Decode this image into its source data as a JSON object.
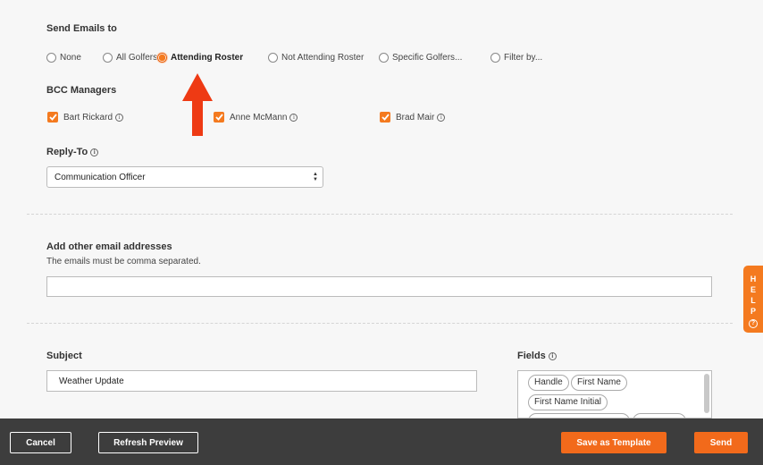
{
  "send_emails": {
    "label": "Send Emails to",
    "options": [
      "None",
      "All Golfers",
      "Attending Roster",
      "Not Attending Roster",
      "Specific Golfers...",
      "Filter by..."
    ],
    "selected": "Attending Roster"
  },
  "bcc": {
    "label": "BCC Managers",
    "managers": [
      "Bart Rickard",
      "Anne McMann",
      "Brad Mair"
    ]
  },
  "reply_to": {
    "label": "Reply-To",
    "value": "Communication Officer"
  },
  "other_emails": {
    "label": "Add other email addresses",
    "hint": "The emails must be comma separated.",
    "value": ""
  },
  "subject": {
    "label": "Subject",
    "value": "Weather Update"
  },
  "fields": {
    "label": "Fields",
    "chips": [
      "Handle",
      "First Name",
      "First Name Initial"
    ]
  },
  "help": {
    "letters": [
      "H",
      "E",
      "L",
      "P"
    ],
    "question": "?"
  },
  "info_glyph": "i",
  "footer": {
    "cancel": "Cancel",
    "refresh": "Refresh Preview",
    "save_template": "Save as Template",
    "send": "Send"
  },
  "colors": {
    "accent": "#f47a1f",
    "footer_bg": "#3d3d3d"
  }
}
